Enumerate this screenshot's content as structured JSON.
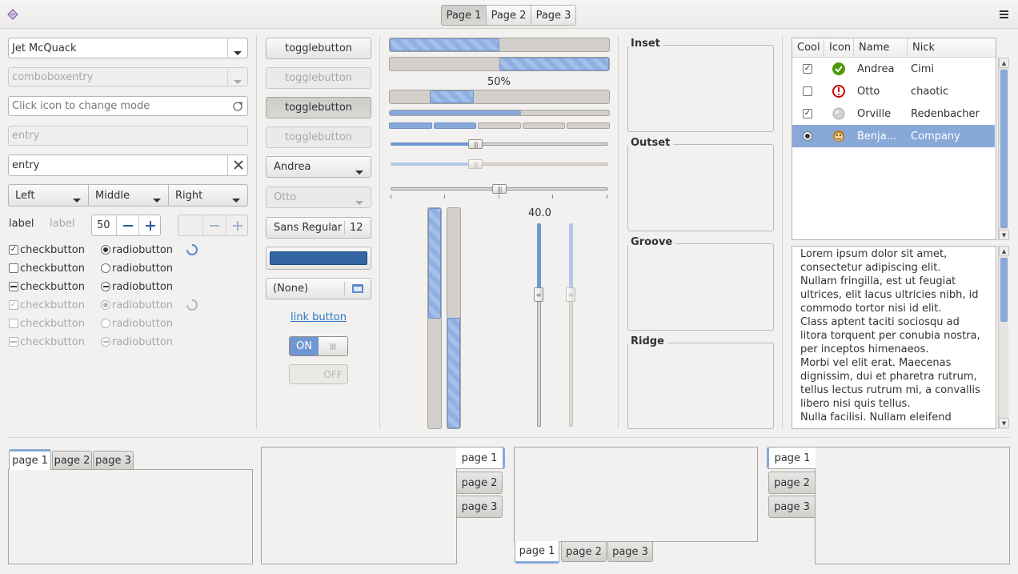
{
  "header": {
    "stack_tabs": [
      "Page 1",
      "Page 2",
      "Page 3"
    ],
    "menu_icon": "hamburger-menu-icon",
    "app_icon": "gtk-logo-icon"
  },
  "left": {
    "combo_value": "Jet McQuack",
    "combo_entry_placeholder": "comboboxentry",
    "mode_entry_placeholder": "Click icon to change mode",
    "entry_disabled": "entry",
    "entry_value": "entry",
    "segmented": [
      "Left",
      "Middle",
      "Right"
    ],
    "label": "label",
    "label_disabled": "label",
    "spin_value": "50",
    "checks": [
      {
        "label": "checkbutton",
        "state": "checked",
        "radio_label": "radiobutton",
        "radio_state": "on"
      },
      {
        "label": "checkbutton",
        "state": "unchecked",
        "radio_label": "radiobutton",
        "radio_state": "off"
      },
      {
        "label": "checkbutton",
        "state": "mixed",
        "radio_label": "radiobutton",
        "radio_state": "mixed"
      },
      {
        "label": "checkbutton",
        "state": "checked",
        "radio_label": "radiobutton",
        "radio_state": "on"
      },
      {
        "label": "checkbutton",
        "state": "unchecked",
        "radio_label": "radiobutton",
        "radio_state": "off"
      },
      {
        "label": "checkbutton",
        "state": "mixed",
        "radio_label": "radiobutton",
        "radio_state": "mixed"
      }
    ]
  },
  "col2": {
    "toggle": [
      "togglebutton",
      "togglebutton",
      "togglebutton",
      "togglebutton"
    ],
    "combo_andrea": "Andrea",
    "combo_otto": "Otto",
    "font_name": "Sans Regular",
    "font_size": "12",
    "color_value": "#3465a4",
    "file_value": "(None)",
    "link": "link button",
    "switch_on": "ON",
    "switch_off": "OFF"
  },
  "col3": {
    "progress_label": "50%",
    "progress": [
      0.5,
      0.5,
      0.2,
      0.6,
      0.4
    ],
    "hscale_value": "40.0",
    "hscale_levels": [
      0.39,
      0.39,
      0.5
    ],
    "vprogress_levels": [
      0.5,
      0.5
    ],
    "vscale_levels": [
      0.35,
      0.35
    ]
  },
  "frames": [
    "Inset",
    "Outset",
    "Groove",
    "Ridge"
  ],
  "tree": {
    "columns": [
      "Cool",
      "Icon",
      "Name",
      "Nick"
    ],
    "rows": [
      {
        "cool": "checked",
        "icon": "green-check-icon",
        "name": "Andrea",
        "nick": "Cimi"
      },
      {
        "cool": "unchecked",
        "icon": "red-alert-icon",
        "name": "Otto",
        "nick": "chaotic"
      },
      {
        "cool": "checked",
        "icon": "gray-orb-icon",
        "name": "Orville",
        "nick": "Redenbacher"
      },
      {
        "cool": "radio",
        "icon": "monkey-face-icon",
        "name": "Benja...",
        "nick": "Company"
      }
    ]
  },
  "text": [
    "Lorem ipsum dolor sit amet,",
    "consectetur adipiscing elit.",
    "Nullam fringilla, est ut feugiat",
    "ultrices, elit lacus ultricies nibh, id",
    "commodo tortor nisi id elit.",
    "Class aptent taciti sociosqu ad",
    "litora torquent per conubia nostra,",
    "per inceptos himenaeos.",
    "Morbi vel elit erat. Maecenas",
    "dignissim, dui et pharetra rutrum,",
    "tellus lectus rutrum mi, a convallis",
    "libero nisi quis tellus.",
    "Nulla facilisi. Nullam eleifend"
  ],
  "notebooks": {
    "tabs": [
      "page 1",
      "page 2",
      "page 3"
    ]
  },
  "colors": {
    "accent": "#88a8d8",
    "accent_dark": "#3465a4",
    "bg": "#f2f1f0"
  }
}
